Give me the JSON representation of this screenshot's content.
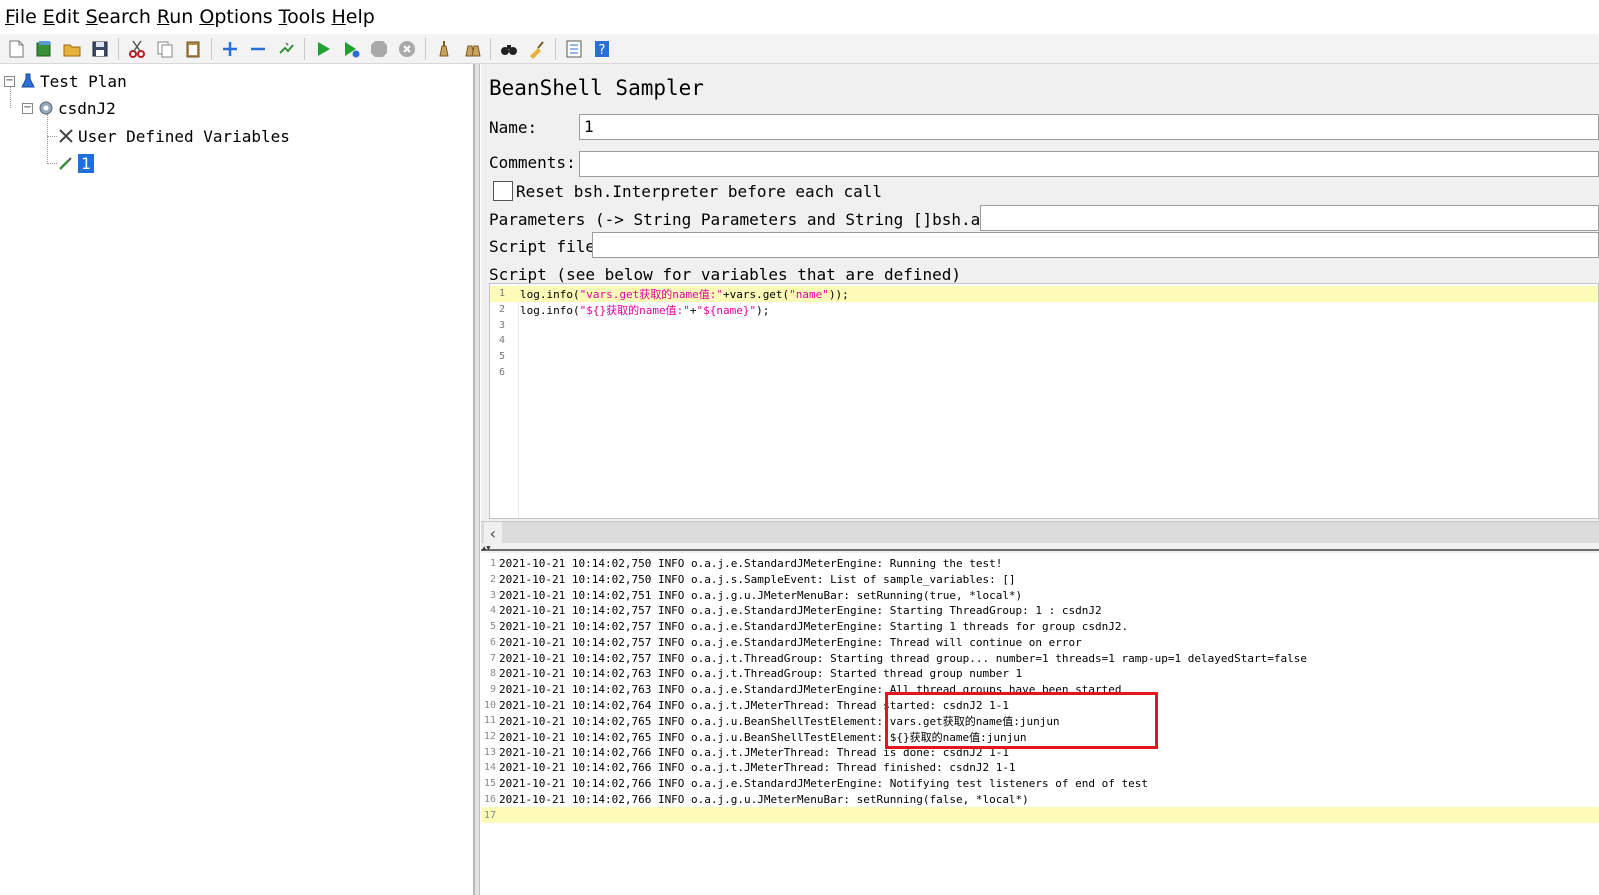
{
  "menu": [
    {
      "mnemonic": "F",
      "rest": "ile"
    },
    {
      "mnemonic": "E",
      "rest": "dit"
    },
    {
      "mnemonic": "S",
      "rest": "earch"
    },
    {
      "mnemonic": "R",
      "rest": "un"
    },
    {
      "mnemonic": "O",
      "rest": "ptions"
    },
    {
      "mnemonic": "T",
      "rest": "ools"
    },
    {
      "mnemonic": "H",
      "rest": "elp"
    }
  ],
  "toolbar": {
    "icons": [
      "new-icon",
      "templates-icon",
      "open-icon",
      "save-icon",
      "cut-icon",
      "copy-icon",
      "paste-icon",
      "expand-icon",
      "collapse-icon",
      "toggle-icon",
      "start-icon",
      "start-no-pauses-icon",
      "stop-icon",
      "shutdown-icon",
      "clear-icon",
      "clear-all-icon",
      "search-icon",
      "reset-search-icon",
      "function-helper-icon",
      "help-icon"
    ]
  },
  "tree": {
    "test_plan": "Test Plan",
    "thread_group": "csdnJ2",
    "user_defined_variables": "User Defined Variables",
    "sampler": "1"
  },
  "panel": {
    "title": "BeanShell Sampler",
    "name_label": "Name:",
    "name_value": "1",
    "comments_label": "Comments:",
    "comments_value": "",
    "reset_label": "Reset bsh.Interpreter before each call",
    "parameters_label": "Parameters (-> String Parameters and String []bsh.args)",
    "parameters_value": "",
    "script_file_label": "Script file",
    "script_file_value": "",
    "script_label": "Script (see below for variables that are defined)"
  },
  "script": {
    "line_numbers": [
      "1",
      "2",
      "3",
      "4",
      "5",
      "6"
    ],
    "line1": {
      "prefix": "log.info(",
      "string": "\"vars.get获取的name值:\"",
      "mid": "+vars.get(",
      "string2": "\"name\"",
      "suffix": "));"
    },
    "line2": {
      "prefix": "log.info(",
      "string": "\"${}获取的name值:\"",
      "mid": "+",
      "string2": "\"${name}\"",
      "suffix": ");"
    }
  },
  "log": [
    "2021-10-21 10:14:02,750 INFO o.a.j.e.StandardJMeterEngine: Running the test!",
    "2021-10-21 10:14:02,750 INFO o.a.j.s.SampleEvent: List of sample_variables: []",
    "2021-10-21 10:14:02,751 INFO o.a.j.g.u.JMeterMenuBar: setRunning(true, *local*)",
    "2021-10-21 10:14:02,757 INFO o.a.j.e.StandardJMeterEngine: Starting ThreadGroup: 1 : csdnJ2",
    "2021-10-21 10:14:02,757 INFO o.a.j.e.StandardJMeterEngine: Starting 1 threads for group csdnJ2.",
    "2021-10-21 10:14:02,757 INFO o.a.j.e.StandardJMeterEngine: Thread will continue on error",
    "2021-10-21 10:14:02,757 INFO o.a.j.t.ThreadGroup: Starting thread group... number=1 threads=1 ramp-up=1 delayedStart=false",
    "2021-10-21 10:14:02,763 INFO o.a.j.t.ThreadGroup: Started thread group number 1",
    "2021-10-21 10:14:02,763 INFO o.a.j.e.StandardJMeterEngine: All thread groups have been started",
    "2021-10-21 10:14:02,764 INFO o.a.j.t.JMeterThread: Thread started: csdnJ2 1-1",
    "2021-10-21 10:14:02,765 INFO o.a.j.u.BeanShellTestElement: vars.get获取的name值:junjun",
    "2021-10-21 10:14:02,765 INFO o.a.j.u.BeanShellTestElement: ${}获取的name值:junjun",
    "2021-10-21 10:14:02,766 INFO o.a.j.t.JMeterThread: Thread is done: csdnJ2 1-1",
    "2021-10-21 10:14:02,766 INFO o.a.j.t.JMeterThread: Thread finished: csdnJ2 1-1",
    "2021-10-21 10:14:02,766 INFO o.a.j.e.StandardJMeterEngine: Notifying test listeners of end of test",
    "2021-10-21 10:14:02,766 INFO o.a.j.g.u.JMeterMenuBar: setRunning(false, *local*)",
    ""
  ],
  "colors": {
    "selection": "#1e6fd9",
    "string": "#e0009f",
    "highlight_line": "#fdfbb8",
    "annotation_box": "#e8131b"
  }
}
